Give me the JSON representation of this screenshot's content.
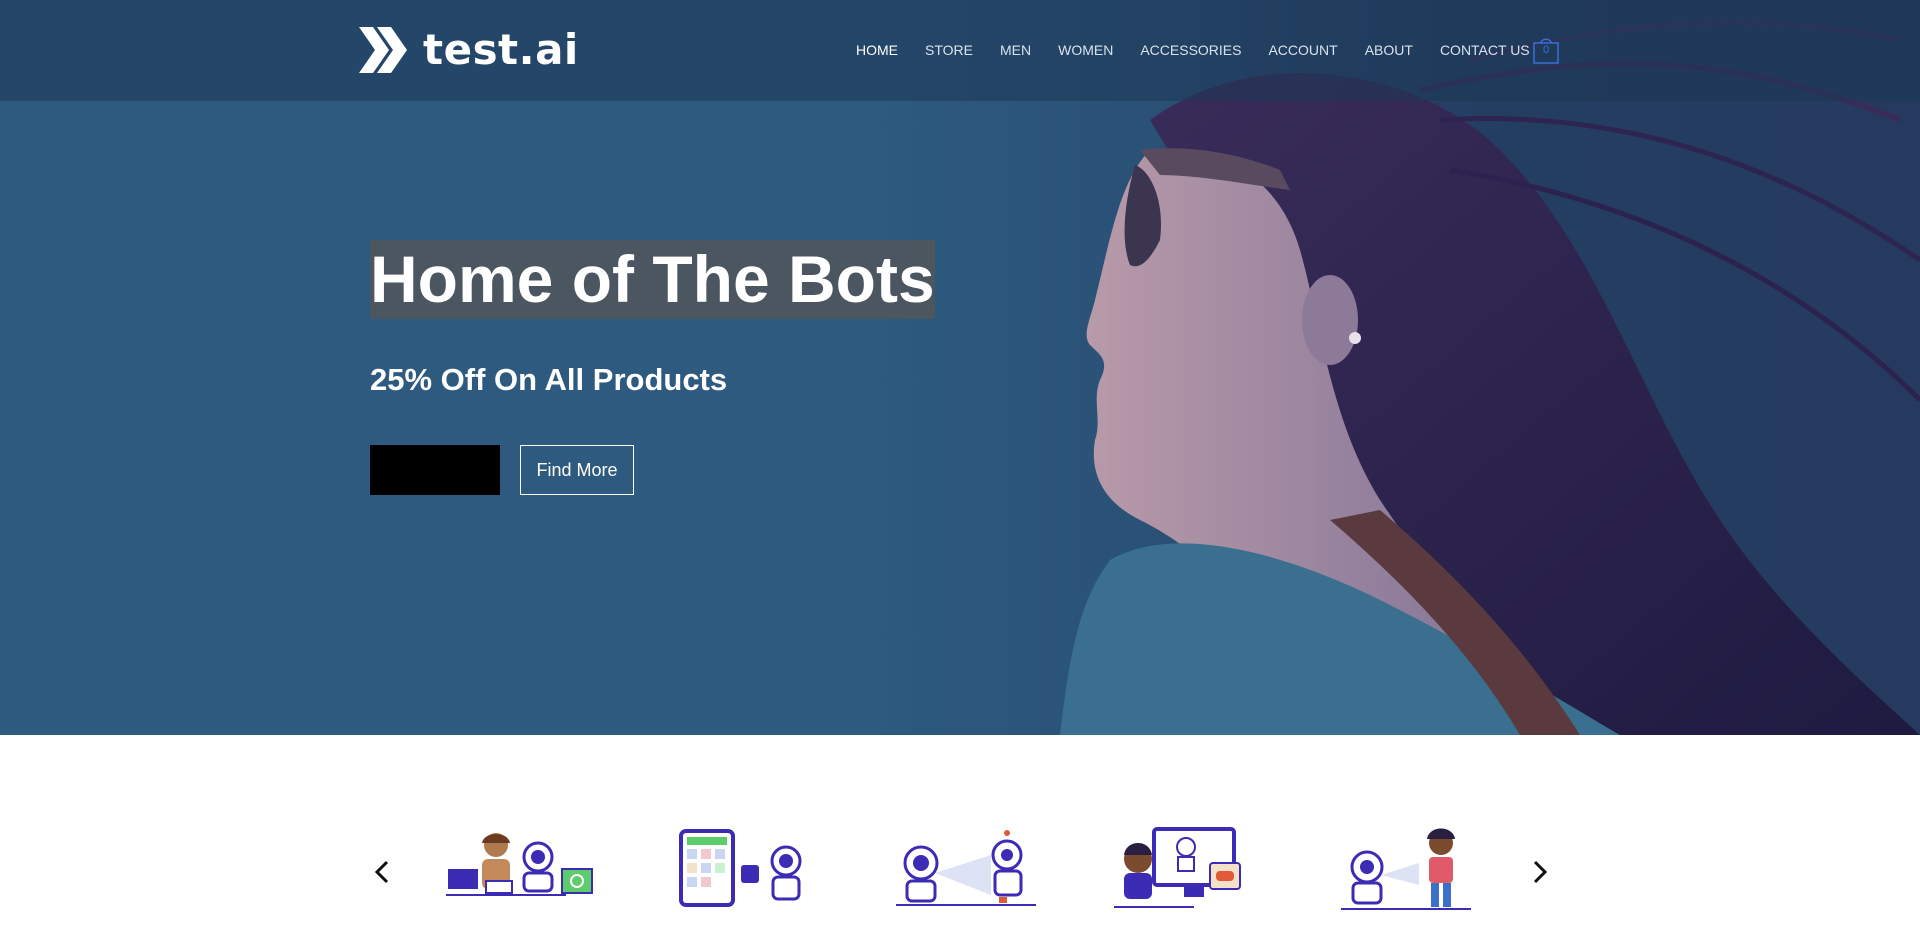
{
  "brand": {
    "name": "test.ai"
  },
  "nav": {
    "items": [
      {
        "label": "HOME",
        "active": true
      },
      {
        "label": "STORE"
      },
      {
        "label": "MEN"
      },
      {
        "label": "WOMEN"
      },
      {
        "label": "ACCESSORIES"
      },
      {
        "label": "ACCOUNT"
      },
      {
        "label": "ABOUT"
      },
      {
        "label": "CONTACT US"
      }
    ],
    "cart_count": "0"
  },
  "hero": {
    "headline": "Home of The Bots",
    "subheadline": "25% Off On All Products",
    "primary_button_label": "",
    "secondary_button_label": "Find More"
  },
  "carousel": {
    "slides": [
      {
        "icon": "person-and-robots-with-laptops-icon"
      },
      {
        "icon": "tablet-and-robot-icon"
      },
      {
        "icon": "robots-scanning-icon"
      },
      {
        "icon": "person-monitor-robot-gamepad-icon"
      },
      {
        "icon": "robot-and-person-icon"
      }
    ]
  },
  "colors": {
    "accent": "#3a6fd8",
    "hero_bg": "#2e5a80",
    "bot_purple": "#3b2bb5"
  }
}
